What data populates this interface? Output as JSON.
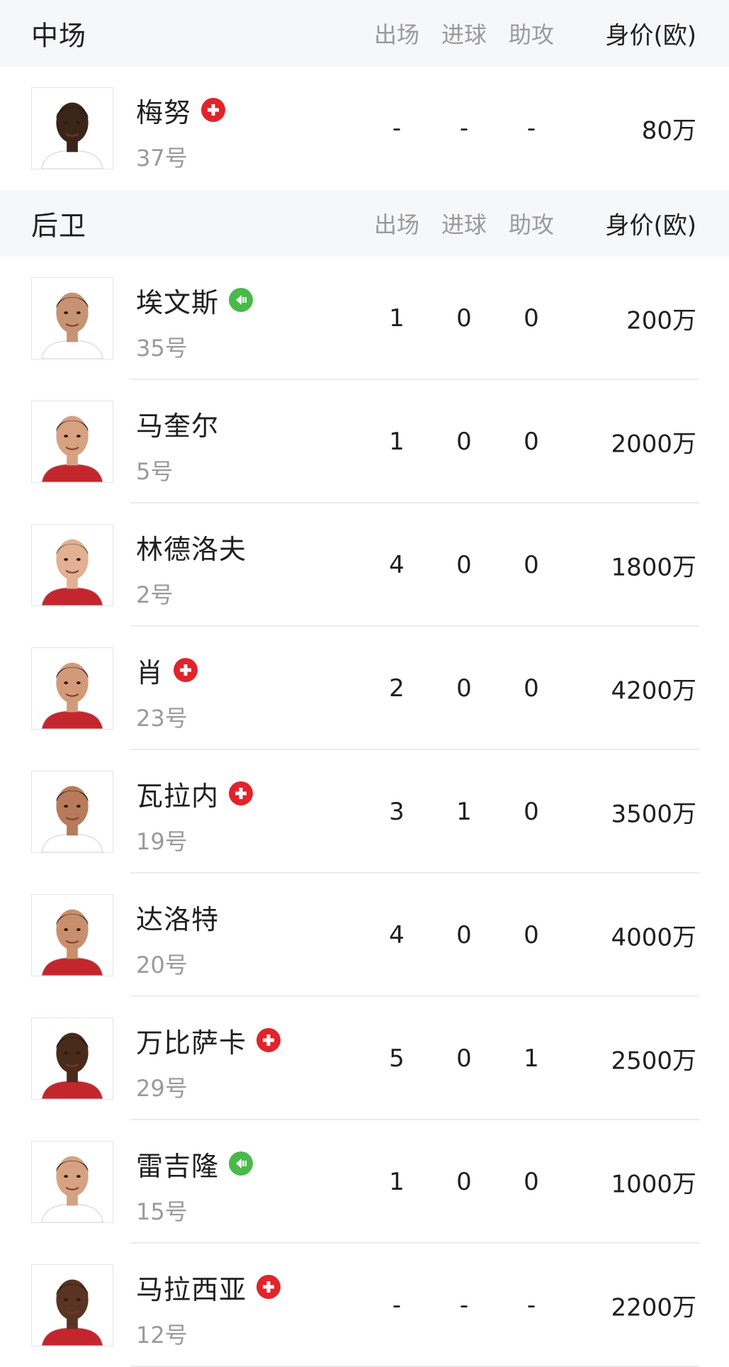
{
  "sections": [
    {
      "title": "中场",
      "columns": {
        "apps": "出场",
        "goals": "进球",
        "assists": "助攻",
        "value": "身价(欧)"
      },
      "players": [
        {
          "name": "梅努",
          "number": "37号",
          "status_icon": "injury-cross-icon",
          "apps": "-",
          "goals": "-",
          "assists": "-",
          "value": "80万"
        }
      ]
    },
    {
      "title": "后卫",
      "columns": {
        "apps": "出场",
        "goals": "进球",
        "assists": "助攻",
        "value": "身价(欧)"
      },
      "players": [
        {
          "name": "埃文斯",
          "number": "35号",
          "status_icon": "substitute-in-icon",
          "apps": "1",
          "goals": "0",
          "assists": "0",
          "value": "200万"
        },
        {
          "name": "马奎尔",
          "number": "5号",
          "status_icon": "",
          "apps": "1",
          "goals": "0",
          "assists": "0",
          "value": "2000万"
        },
        {
          "name": "林德洛夫",
          "number": "2号",
          "status_icon": "",
          "apps": "4",
          "goals": "0",
          "assists": "0",
          "value": "1800万"
        },
        {
          "name": "肖",
          "number": "23号",
          "status_icon": "injury-cross-icon",
          "apps": "2",
          "goals": "0",
          "assists": "0",
          "value": "4200万"
        },
        {
          "name": "瓦拉内",
          "number": "19号",
          "status_icon": "injury-cross-icon",
          "apps": "3",
          "goals": "1",
          "assists": "0",
          "value": "3500万"
        },
        {
          "name": "达洛特",
          "number": "20号",
          "status_icon": "",
          "apps": "4",
          "goals": "0",
          "assists": "0",
          "value": "4000万"
        },
        {
          "name": "万比萨卡",
          "number": "29号",
          "status_icon": "injury-cross-icon",
          "apps": "5",
          "goals": "0",
          "assists": "1",
          "value": "2500万"
        },
        {
          "name": "雷吉隆",
          "number": "15号",
          "status_icon": "substitute-in-icon",
          "apps": "1",
          "goals": "0",
          "assists": "0",
          "value": "1000万"
        },
        {
          "name": "马拉西亚",
          "number": "12号",
          "status_icon": "injury-cross-icon",
          "apps": "-",
          "goals": "-",
          "assists": "-",
          "value": "2200万"
        }
      ]
    }
  ],
  "colors": {
    "injury_badge": "#e1242c",
    "substitute_badge": "#49b94a",
    "header_bg": "#f6f7f9",
    "muted_text": "#9a9a9a"
  }
}
